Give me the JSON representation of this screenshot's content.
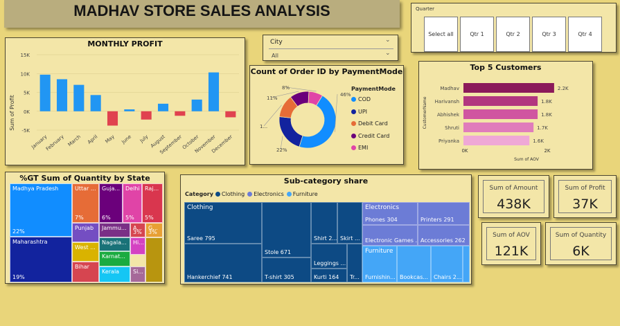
{
  "title": "MADHAV STORE SALES ANALYSIS",
  "quarter_slicer": {
    "label": "Quarter",
    "options": [
      "Select all",
      "Qtr 1",
      "Qtr 2",
      "Qtr 3",
      "Qtr 4"
    ]
  },
  "city_slicer": {
    "label": "City",
    "value": "All"
  },
  "monthly_profit": {
    "title": "MONTHLY PROFIT",
    "ylabel": "Sum of Profit",
    "yticks": [
      "15K",
      "10K",
      "5K",
      "0K",
      "-5K"
    ],
    "color": "#2196f3"
  },
  "payment_mode": {
    "title": "Count of Order ID by PaymentMode",
    "legend_title": "PaymentMode",
    "labels": [
      "46%",
      "22%",
      "1...",
      "11%",
      "8%"
    ]
  },
  "top_customers": {
    "title": "Top 5 Customers",
    "ylabel": "CustomerName",
    "xlabel": "Sum of AOV",
    "xticks": [
      "0K",
      "2K"
    ],
    "value_labels": [
      "2.2K",
      "1.8K",
      "1.8K",
      "1.7K",
      "1.6K"
    ]
  },
  "state_quantity": {
    "title": "%GT Sum of Quantity by State",
    "cells": [
      {
        "name": "Madhya Pradesh",
        "pct": "22%",
        "color": "#118dff"
      },
      {
        "name": "Maharashtra",
        "pct": "19%",
        "color": "#12239e"
      },
      {
        "name": "Uttar ...",
        "pct": "7%",
        "color": "#e66c37"
      },
      {
        "name": "Guja...",
        "pct": "6%",
        "color": "#6b007b"
      },
      {
        "name": "Delhi",
        "pct": "5%",
        "color": "#e044a7"
      },
      {
        "name": "Raj...",
        "pct": "5%",
        "color": "#d9364e"
      },
      {
        "name": "Punjab",
        "pct": "",
        "color": "#744ec2"
      },
      {
        "name": "Jammu...",
        "pct": "",
        "color": "#7a2f86"
      },
      {
        "name": "A...",
        "pct": "3%",
        "color": "#d64550"
      },
      {
        "name": "G...",
        "pct": "3%",
        "color": "#e8a034"
      },
      {
        "name": "West ...",
        "pct": "",
        "color": "#d9b300"
      },
      {
        "name": "Nagala...",
        "pct": "",
        "color": "#197278"
      },
      {
        "name": "Hi...",
        "pct": "",
        "color": "#d442c2"
      },
      {
        "name": "Karnat...",
        "pct": "",
        "color": "#1aab40"
      },
      {
        "name": "Bihar",
        "pct": "",
        "color": "#d64550"
      },
      {
        "name": "Kerala",
        "pct": "",
        "color": "#15c6f4"
      },
      {
        "name": "Si...",
        "pct": "",
        "color": "#a66999"
      },
      {
        "name": "",
        "pct": "",
        "color": "#b8950f"
      }
    ]
  },
  "subcategory": {
    "title": "Sub-category share",
    "legend_title": "Category",
    "legend": [
      {
        "name": "Clothing",
        "color": "#0d4a84"
      },
      {
        "name": "Electronics",
        "color": "#6c7cd6"
      },
      {
        "name": "Furniture",
        "color": "#44a6f7"
      }
    ],
    "group_labels": [
      "Clothing",
      "Electronics",
      "Furniture"
    ],
    "cells": [
      "Saree 795",
      "Hankerchief 741",
      "Stole 671",
      "T-shirt 305",
      "Shirt 2...",
      "Skirt ...",
      "Leggings ...",
      "Kurti 164",
      "Tr...",
      "Phones 304",
      "Printers 291",
      "Electronic Games ...",
      "Accessories 262",
      "Furnishin...",
      "Bookcas...",
      "Chairs 2..."
    ]
  },
  "kpis": {
    "amount": {
      "label": "Sum of Amount",
      "value": "438K"
    },
    "profit": {
      "label": "Sum of Profit",
      "value": "37K"
    },
    "aov": {
      "label": "Sum of AOV",
      "value": "121K"
    },
    "quantity": {
      "label": "Sum of Quantity",
      "value": "6K"
    }
  },
  "chart_data": [
    {
      "type": "bar",
      "title": "MONTHLY PROFIT",
      "xlabel": "",
      "ylabel": "Sum of Profit",
      "categories": [
        "January",
        "February",
        "March",
        "April",
        "May",
        "June",
        "July",
        "August",
        "September",
        "October",
        "November",
        "December"
      ],
      "values": [
        9700,
        8500,
        7000,
        4300,
        -3800,
        500,
        -2200,
        2000,
        -1200,
        3100,
        10300,
        -1600
      ],
      "ylim": [
        -5000,
        15000
      ]
    },
    {
      "type": "pie",
      "title": "Count of Order ID by PaymentMode",
      "categories": [
        "COD",
        "UPI",
        "Debit Card",
        "Credit Card",
        "EMI"
      ],
      "values": [
        46,
        22,
        13,
        11,
        8
      ],
      "colors": [
        "#118dff",
        "#12239e",
        "#e66c37",
        "#6b007b",
        "#e044a7"
      ]
    },
    {
      "type": "bar",
      "title": "Top 5 Customers",
      "xlabel": "Sum of AOV",
      "ylabel": "CustomerName",
      "categories": [
        "Madhav",
        "Harivansh",
        "Abhishek",
        "Shruti",
        "Priyanka"
      ],
      "values": [
        2200,
        1800,
        1800,
        1700,
        1600
      ],
      "xlim": [
        0,
        2500
      ],
      "colors": [
        "#8b1a5a",
        "#b2367f",
        "#d055a0",
        "#e07cbb",
        "#efa8d6"
      ]
    }
  ]
}
